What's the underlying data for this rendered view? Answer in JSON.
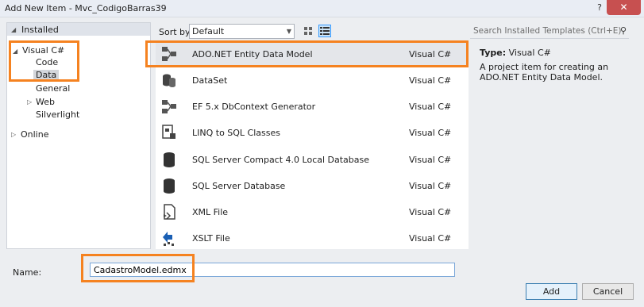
{
  "window": {
    "title": "Add New Item - Mvc_CodigoBarras39",
    "help_label": "?",
    "close_label": "✕"
  },
  "tree": {
    "installed": "Installed",
    "visual_csharp": "Visual C#",
    "code": "Code",
    "data": "Data",
    "general": "General",
    "web": "Web",
    "silverlight": "Silverlight",
    "online": "Online"
  },
  "toolbar": {
    "sort_label": "Sort by:",
    "sort_value": "Default",
    "search_placeholder": "Search Installed Templates (Ctrl+E)"
  },
  "templates": [
    {
      "name": "ADO.NET Entity Data Model",
      "language": "Visual C#",
      "icon": "entity-model-icon"
    },
    {
      "name": "DataSet",
      "language": "Visual C#",
      "icon": "dataset-icon"
    },
    {
      "name": "EF 5.x DbContext Generator",
      "language": "Visual C#",
      "icon": "ef-generator-icon"
    },
    {
      "name": "LINQ to SQL Classes",
      "language": "Visual C#",
      "icon": "linq-icon"
    },
    {
      "name": "SQL Server Compact 4.0 Local Database",
      "language": "Visual C#",
      "icon": "database-icon"
    },
    {
      "name": "SQL Server Database",
      "language": "Visual C#",
      "icon": "database-icon"
    },
    {
      "name": "XML File",
      "language": "Visual C#",
      "icon": "xml-file-icon"
    },
    {
      "name": "XSLT File",
      "language": "Visual C#",
      "icon": "xslt-file-icon"
    }
  ],
  "details": {
    "type_label": "Type:",
    "type_value": "Visual C#",
    "description": "A project item for creating an ADO.NET Entity Data Model."
  },
  "bottom": {
    "name_label": "Name:",
    "name_value": "CadastroModel.edmx",
    "add_label": "Add",
    "cancel_label": "Cancel"
  },
  "colors": {
    "highlight": "#f58220",
    "selected_row": "#e4e6ea",
    "close_button": "#c75050"
  }
}
